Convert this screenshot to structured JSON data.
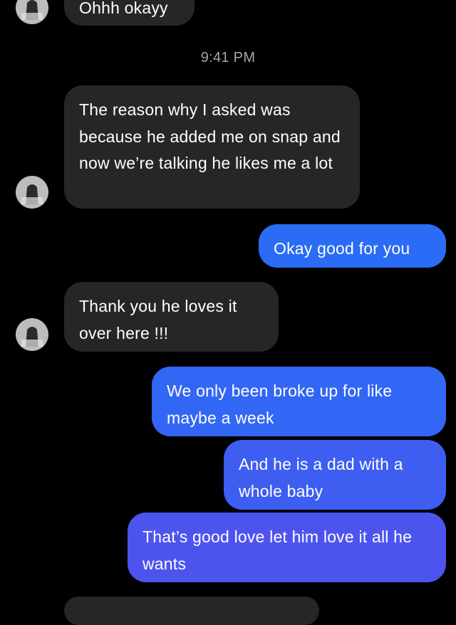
{
  "timestamp": "9:41 PM",
  "colors": {
    "incoming": "#262628",
    "outgoing_top": "#2a6cf6",
    "outgoing_bottom": "#4d54ee"
  },
  "messages": [
    {
      "from": "them",
      "text": "Ohhh okayy"
    },
    {
      "from": "them",
      "text": "The reason why I asked was because he added me on snap and now we’re talking he likes me a lot"
    },
    {
      "from": "me",
      "text": "Okay good for you"
    },
    {
      "from": "them",
      "text": "Thank you he loves it over here !!!"
    },
    {
      "from": "me",
      "text": "We only been broke up for like maybe a week"
    },
    {
      "from": "me",
      "text": "And he is a dad with a whole baby"
    },
    {
      "from": "me",
      "text": "That’s good love let him love it all he wants"
    }
  ]
}
